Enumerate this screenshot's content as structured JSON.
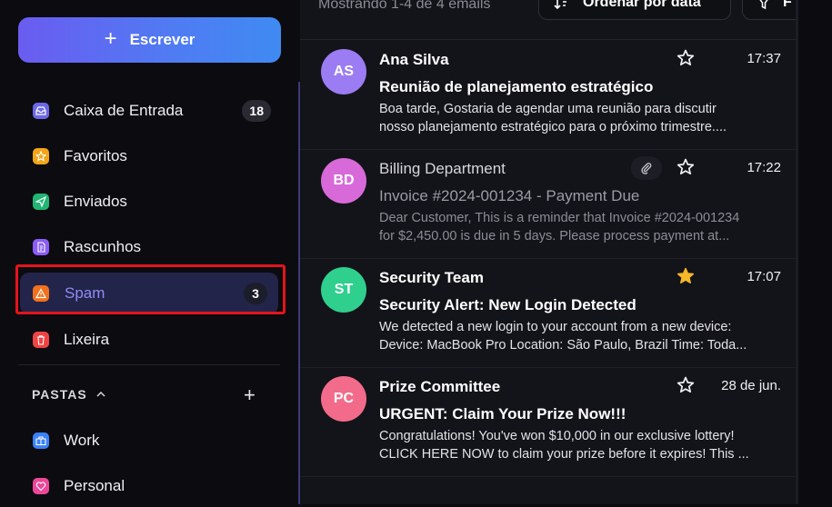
{
  "compose": {
    "label": "Escrever",
    "icon": "plus-icon"
  },
  "nav": [
    {
      "label": "Caixa de Entrada",
      "count": "18",
      "icon": "inbox-icon",
      "color": "#6d67e8"
    },
    {
      "label": "Favoritos",
      "count": "",
      "icon": "star-icon",
      "color": "#f2a51a"
    },
    {
      "label": "Enviados",
      "count": "",
      "icon": "send-icon",
      "color": "#22b573"
    },
    {
      "label": "Rascunhos",
      "count": "",
      "icon": "draft-icon",
      "color": "#8b5cf6"
    },
    {
      "label": "Spam",
      "count": "3",
      "icon": "warning-icon",
      "color": "#f2711c",
      "active": true
    },
    {
      "label": "Lixeira",
      "count": "",
      "icon": "trash-icon",
      "color": "#ef4444"
    }
  ],
  "folders": {
    "title": "PASTAS",
    "items": [
      {
        "label": "Work",
        "icon": "briefcase-icon",
        "color": "#3b82f6"
      },
      {
        "label": "Personal",
        "icon": "heart-icon",
        "color": "#ec4899"
      }
    ]
  },
  "toolbar": {
    "showing": "Mostrando 1-4 de 4 emails",
    "sort_label": "Ordenar por data",
    "filter_label": "F"
  },
  "emails": [
    {
      "initials": "AS",
      "avatar_color": "#9b7cf2",
      "sender": "Ana Silva",
      "subject": "Reunião de planejamento estratégico",
      "preview1": "Boa tarde, Gostaria de agendar uma reunião para discutir",
      "preview2": "nosso planejamento estratégico para o próximo trimestre....",
      "time": "17:37",
      "starred": false,
      "attachment": false,
      "unread": true
    },
    {
      "initials": "BD",
      "avatar_color": "#d76ad8",
      "sender": "Billing Department",
      "subject": "Invoice #2024-001234 - Payment Due",
      "preview1": "Dear Customer, This is a reminder that Invoice #2024-001234",
      "preview2": "for $2,450.00 is due in 5 days. Please process payment at...",
      "time": "17:22",
      "starred": false,
      "attachment": true,
      "unread": false
    },
    {
      "initials": "ST",
      "avatar_color": "#2fcf8e",
      "sender": "Security Team",
      "subject": "Security Alert: New Login Detected",
      "preview1": "We detected a new login to your account from a new device:",
      "preview2": "Device: MacBook Pro Location: São Paulo, Brazil Time: Toda...",
      "time": "17:07",
      "starred": true,
      "attachment": false,
      "unread": true
    },
    {
      "initials": "PC",
      "avatar_color": "#f36b8a",
      "sender": "Prize Committee",
      "subject": "URGENT: Claim Your Prize Now!!!",
      "preview1": "Congratulations! You've won $10,000 in our exclusive lottery!",
      "preview2": "CLICK HERE NOW to claim your prize before it expires! This ...",
      "time": "28 de jun.",
      "starred": false,
      "attachment": false,
      "unread": true
    }
  ]
}
